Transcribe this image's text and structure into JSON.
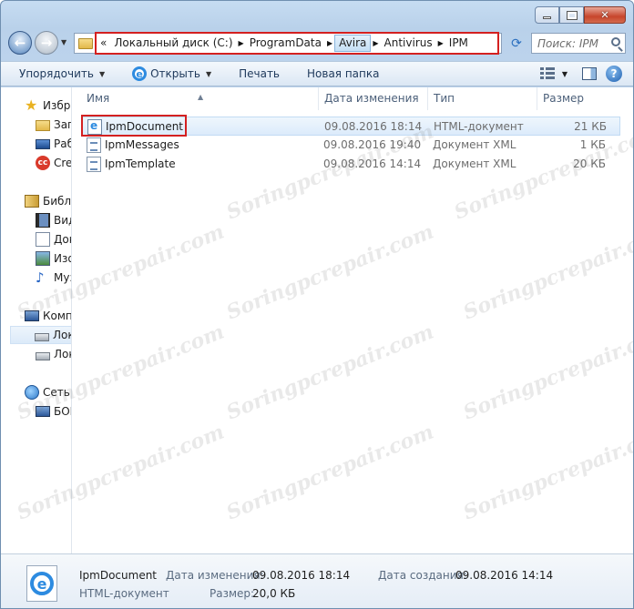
{
  "address": {
    "overflow": "«",
    "crumbs": [
      "Локальный диск (C:)",
      "ProgramData",
      "Avira",
      "Antivirus",
      "IPM"
    ],
    "selected_crumb": 2
  },
  "search": {
    "placeholder": "Поиск: IPM"
  },
  "toolbar": {
    "organize": "Упорядочить",
    "open": "Открыть",
    "print": "Печать",
    "new_folder": "Новая папка"
  },
  "navpane": {
    "items": [
      {
        "label": "Избранное",
        "icon": "star-icon"
      },
      {
        "label": "Загрузки",
        "icon": "folder-icon"
      },
      {
        "label": "Рабочий стол",
        "icon": "desktop-icon"
      },
      {
        "label": "Creative Cloud Files",
        "icon": "creative-cloud-icon"
      },
      {
        "label": "Библиотеки",
        "icon": "library-icon"
      },
      {
        "label": "Видео",
        "icon": "video-icon"
      },
      {
        "label": "Документы",
        "icon": "document-icon"
      },
      {
        "label": "Изображения",
        "icon": "image-icon"
      },
      {
        "label": "Музыка",
        "icon": "music-icon"
      },
      {
        "label": "Компьютер",
        "icon": "computer-icon"
      },
      {
        "label": "Локальный диск (C:)",
        "icon": "drive-icon"
      },
      {
        "label": "Локальный диск (D:)",
        "icon": "drive-icon"
      },
      {
        "label": "Сеть",
        "icon": "network-icon"
      },
      {
        "label": "БОРИС-ПК",
        "icon": "pc-icon"
      }
    ]
  },
  "columns": {
    "name": "Имя",
    "date": "Дата изменения",
    "type": "Тип",
    "size": "Размер"
  },
  "files": [
    {
      "name": "IpmDocument",
      "date": "09.08.2016 18:14",
      "type": "HTML-документ",
      "size": "21 КБ",
      "icon": "html-file-icon"
    },
    {
      "name": "IpmMessages",
      "date": "09.08.2016 19:40",
      "type": "Документ XML",
      "size": "1 КБ",
      "icon": "xml-file-icon"
    },
    {
      "name": "IpmTemplate",
      "date": "09.08.2016 14:14",
      "type": "Документ XML",
      "size": "20 КБ",
      "icon": "xml-file-icon"
    }
  ],
  "watermark": "Soringpcrepair.com",
  "details": {
    "name": "IpmDocument",
    "type": "HTML-документ",
    "modified_label": "Дата изменения:",
    "modified": "09.08.2016 18:14",
    "size_label": "Размер:",
    "size": "20,0 КБ",
    "created_label": "Дата создания:",
    "created": "09.08.2016 14:14"
  },
  "colors": {
    "highlight": "#d42020",
    "selection": "#dcebfb",
    "accent": "#2d8be0"
  }
}
